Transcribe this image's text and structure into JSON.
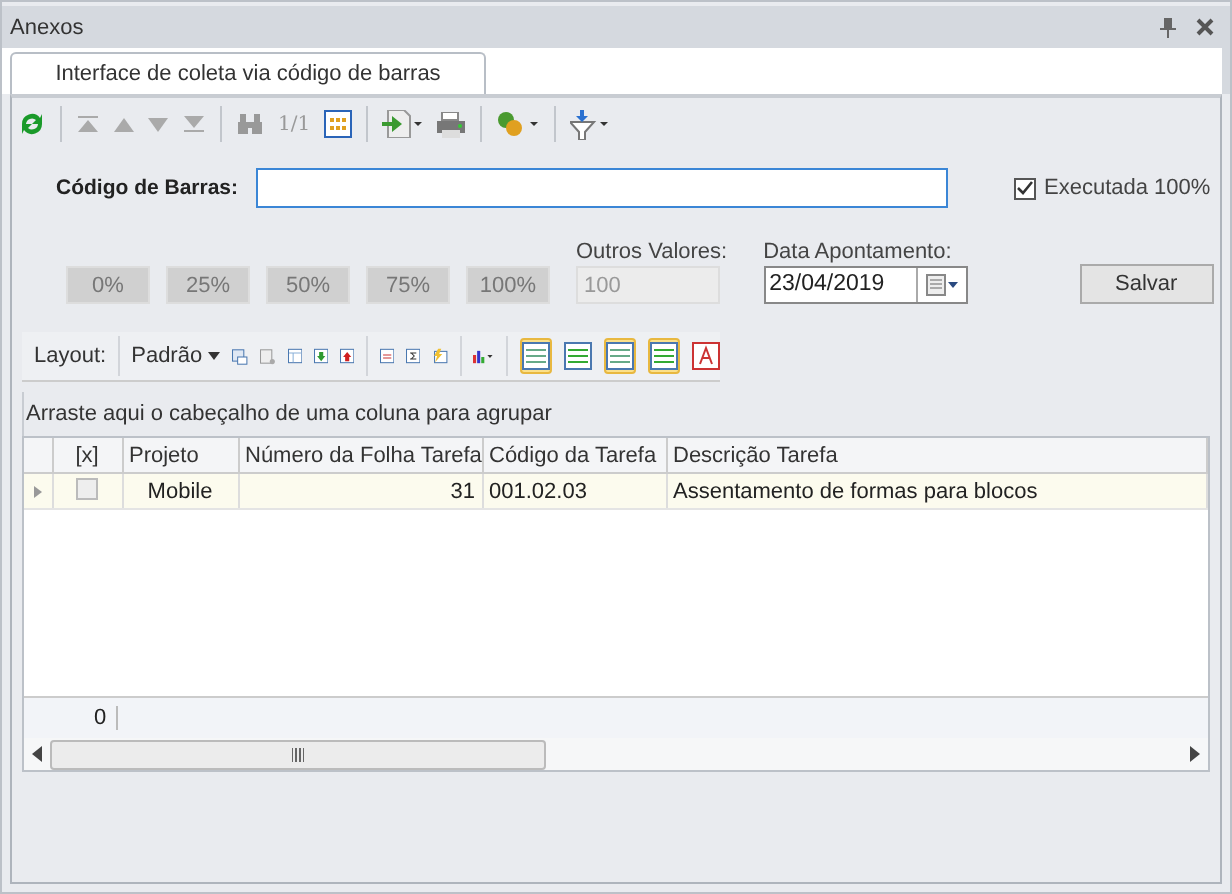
{
  "panel": {
    "title": "Anexos"
  },
  "tabs": [
    {
      "label": "Interface de coleta via código de barras",
      "selected": true
    }
  ],
  "toolbar": {
    "page_counter": "1/1"
  },
  "form": {
    "barcode_label": "Código de Barras:",
    "executed": {
      "label": "Executada 100%",
      "checked": true
    },
    "percent_buttons": [
      "0%",
      "25%",
      "50%",
      "75%",
      "100%"
    ],
    "other_values": {
      "label": "Outros Valores:",
      "value": "100",
      "disabled": true
    },
    "date": {
      "label": "Data Apontamento:",
      "value": "23/04/2019"
    },
    "save_button": "Salvar"
  },
  "grid_toolbar": {
    "layout_label": "Layout:",
    "layout_value": "Padrão",
    "toggles": [
      {
        "on": true
      },
      {
        "on": false
      },
      {
        "on": true
      },
      {
        "on": true
      },
      {
        "on": false
      }
    ]
  },
  "group_panel": "Arraste aqui o cabeçalho de uma coluna para agrupar",
  "table": {
    "columns": [
      "[x]",
      "Projeto",
      "Número da Folha Tarefa",
      "Código da Tarefa",
      "Descrição Tarefa"
    ],
    "rows": [
      {
        "selected": true,
        "checked": false,
        "cells": [
          "",
          "Mobile",
          "31",
          "001.02.03",
          "Assentamento de formas para blocos"
        ]
      }
    ]
  },
  "footer": {
    "count": "0"
  }
}
